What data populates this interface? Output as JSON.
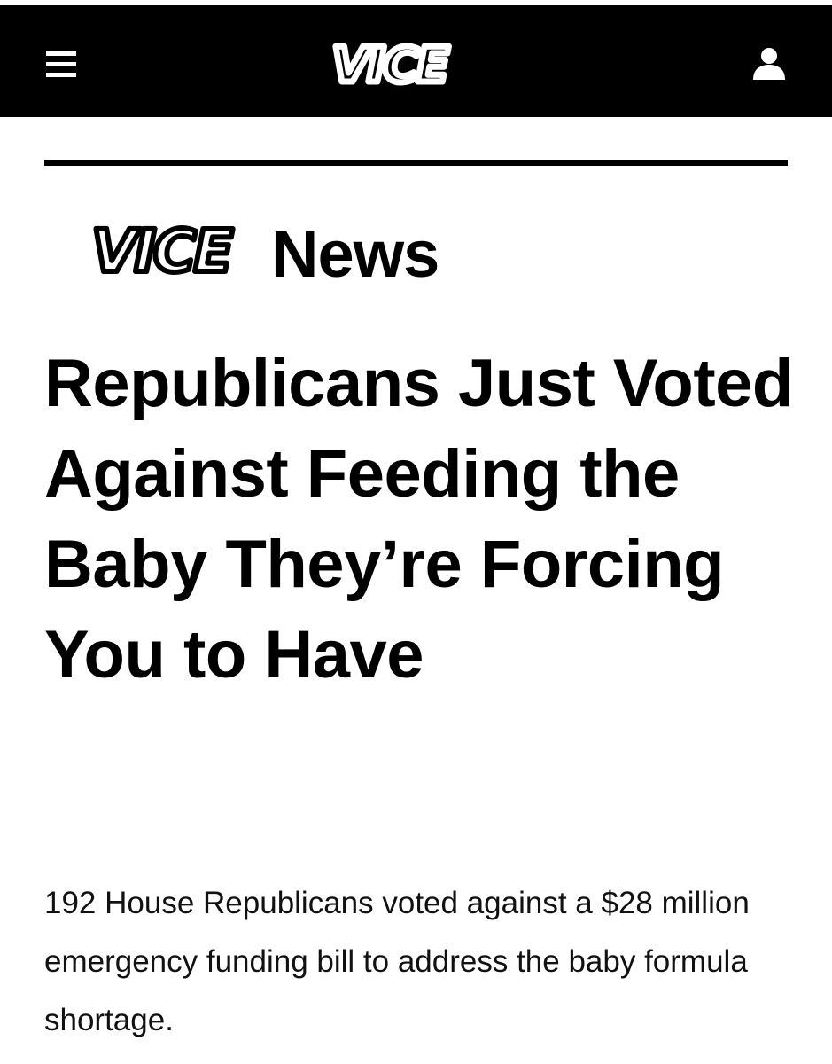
{
  "header": {
    "logo_text": "VICE",
    "menu_icon": "hamburger-menu-icon",
    "user_icon": "user-account-icon"
  },
  "section": {
    "logo_text": "VICE",
    "name": "News"
  },
  "article": {
    "headline": "Republicans Just Voted Against Feeding the Baby They’re Forcing You to Have",
    "dek": "192 House Republicans voted against a $28 million emergency funding bill to address the baby formula shortage."
  },
  "colors": {
    "nav_background": "#000000",
    "page_background": "#ffffff",
    "text": "#000000"
  }
}
